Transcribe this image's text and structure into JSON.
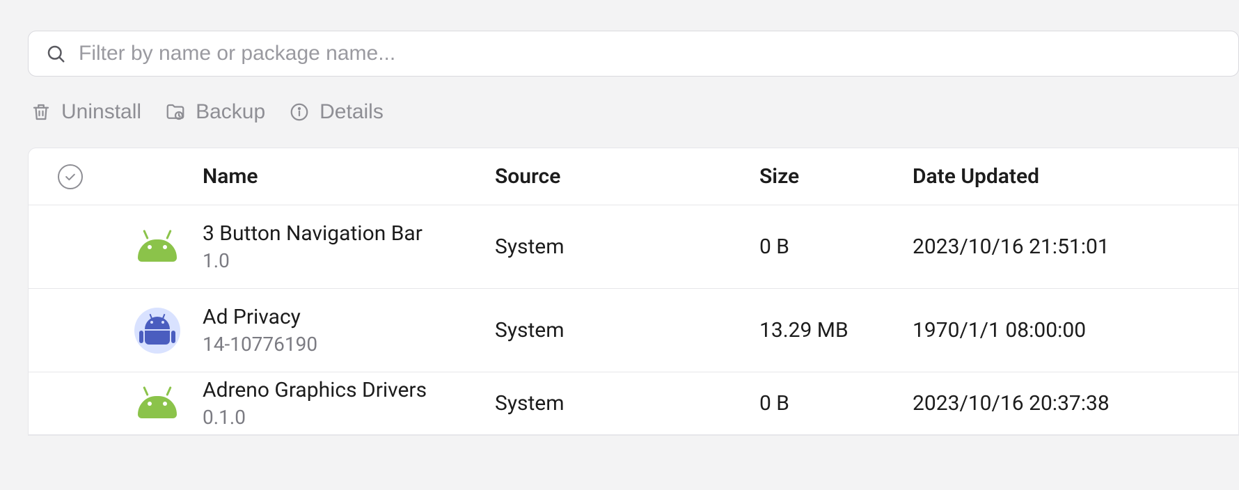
{
  "search": {
    "placeholder": "Filter by name or package name...",
    "value": ""
  },
  "toolbar": {
    "uninstall_label": "Uninstall",
    "backup_label": "Backup",
    "details_label": "Details"
  },
  "table": {
    "headers": {
      "name": "Name",
      "source": "Source",
      "size": "Size",
      "date_updated": "Date Updated"
    },
    "rows": [
      {
        "icon": "android-green",
        "name": "3 Button Navigation Bar",
        "version": "1.0",
        "source": "System",
        "size": "0 B",
        "date_updated": "2023/10/16 21:51:01"
      },
      {
        "icon": "android-blue-circle",
        "name": "Ad Privacy",
        "version": "14-10776190",
        "source": "System",
        "size": "13.29 MB",
        "date_updated": "1970/1/1 08:00:00"
      },
      {
        "icon": "android-green",
        "name": "Adreno Graphics Drivers",
        "version": "0.1.0",
        "source": "System",
        "size": "0 B",
        "date_updated": "2023/10/16 20:37:38"
      }
    ]
  }
}
